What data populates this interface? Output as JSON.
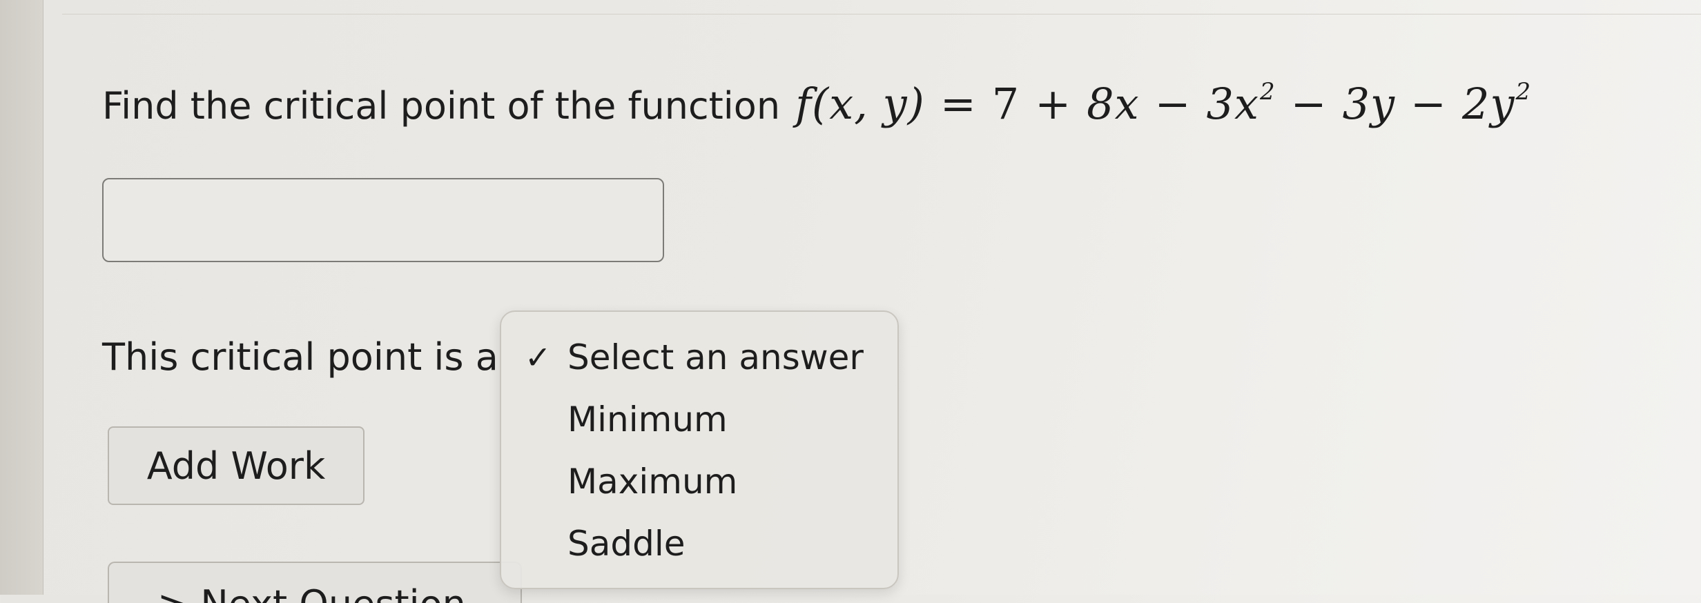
{
  "question": {
    "prompt": "Find the critical point of the function",
    "function_lhs": "f(x, y)",
    "equals": "=",
    "terms": [
      "7",
      "+",
      "8x",
      "−",
      "3x",
      "2",
      "−",
      "3y",
      "−",
      "2y",
      "2"
    ]
  },
  "answer_input": {
    "value": "",
    "placeholder": ""
  },
  "classification": {
    "label": "This critical point is a",
    "options": [
      {
        "label": "Select an answer",
        "selected": true,
        "check": "✓"
      },
      {
        "label": "Minimum",
        "selected": false
      },
      {
        "label": "Maximum",
        "selected": false
      },
      {
        "label": "Saddle",
        "selected": false
      }
    ]
  },
  "buttons": {
    "add_work": "Add Work",
    "next_question": "> Next Question"
  },
  "colors": {
    "background": "#ebe9e5",
    "text": "#1d1d1d",
    "border": "#7d7b77"
  }
}
